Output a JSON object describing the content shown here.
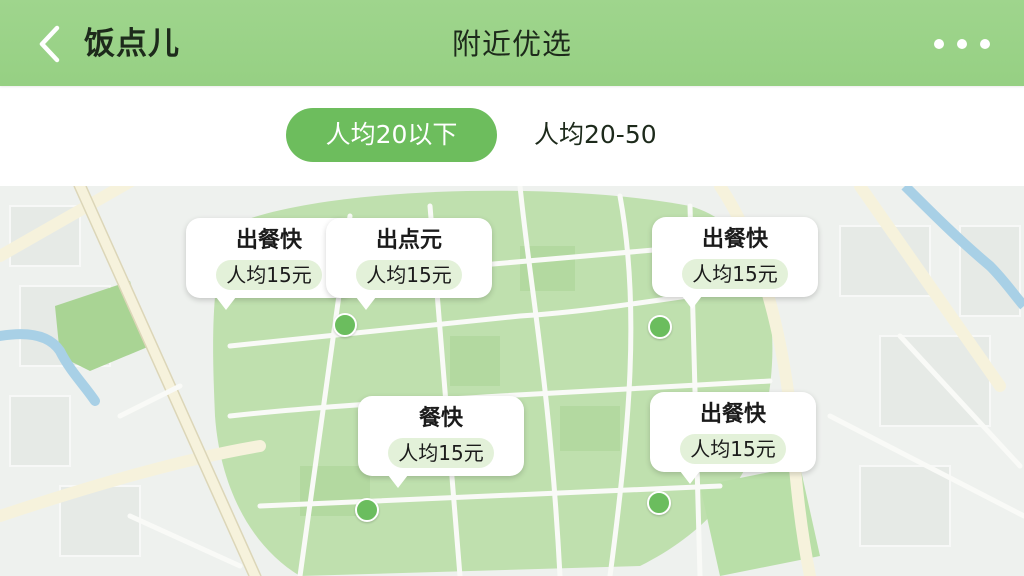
{
  "header": {
    "app_name": "饭点儿",
    "title": "附近优选",
    "back_icon": "chevron-left-icon",
    "more_icon": "more-horizontal-icon"
  },
  "filters": {
    "active": "人均20以下",
    "inactive": "人均20-50"
  },
  "map": {
    "markers": [
      {
        "name": "出餐快",
        "price": "人均15元"
      },
      {
        "name": "出点元",
        "price": "人均15元"
      },
      {
        "name": "出餐快",
        "price": "人均15元"
      },
      {
        "name": "餐快",
        "price": "人均15元"
      },
      {
        "name": "出餐快",
        "price": "人均15元"
      }
    ]
  },
  "colors": {
    "header_bg": "#9fd58d",
    "accent": "#6dbd5d",
    "map_park": "#bfe0ae",
    "map_base": "#eef1ee"
  }
}
